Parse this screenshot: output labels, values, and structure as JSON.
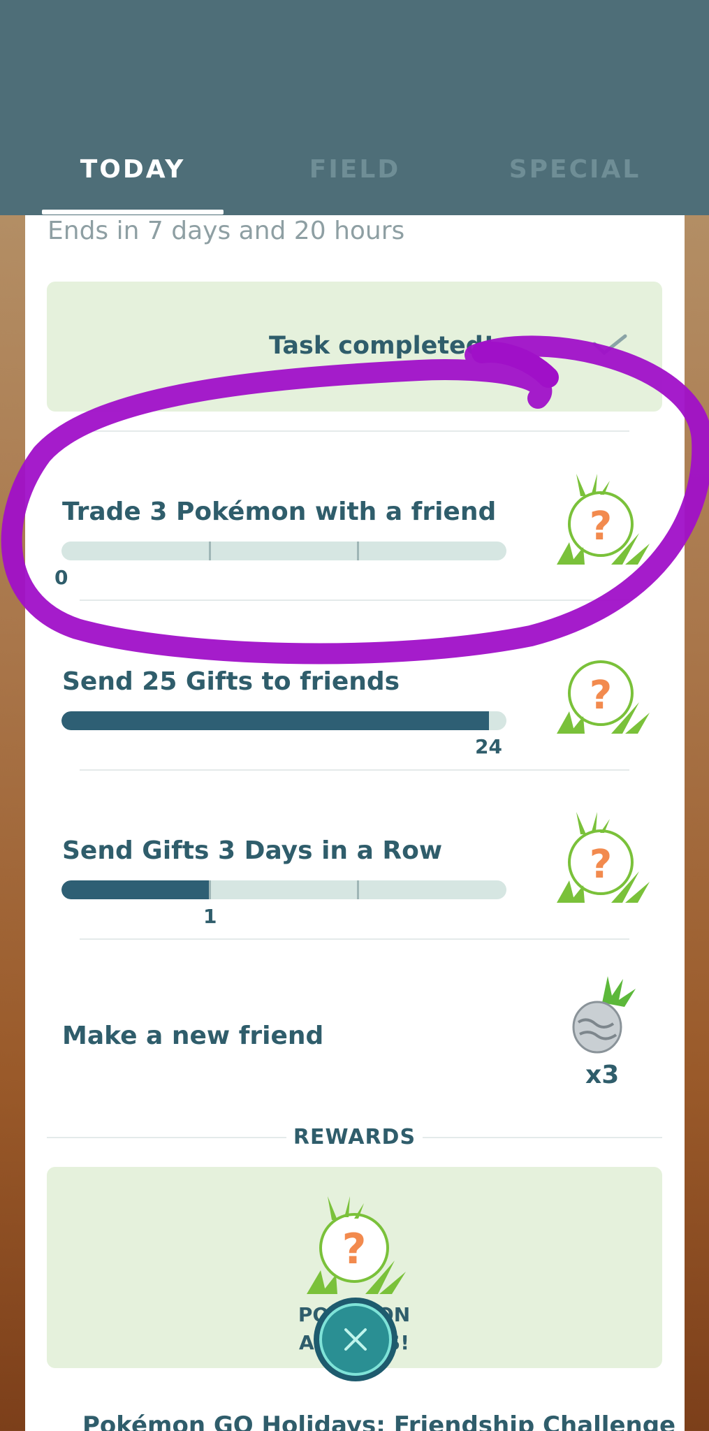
{
  "tabs": [
    {
      "label": "TODAY",
      "active": true
    },
    {
      "label": "FIELD",
      "active": false
    },
    {
      "label": "SPECIAL",
      "active": false
    }
  ],
  "ends_text": "Ends in 7 days and 20 hours",
  "completed": {
    "label": "Task completed!",
    "icon": "checkmark-icon"
  },
  "tasks": [
    {
      "title": "Trade 3 Pokémon with a friend",
      "progress_label": "0",
      "progress": 0.0,
      "segments": 3,
      "reward_icon": "mystery-pokemon-encounter-icon"
    },
    {
      "title": "Send 25 Gifts to friends",
      "progress_label": "24",
      "progress": 0.96,
      "segments": 1,
      "reward_icon": "mystery-pokemon-encounter-icon"
    },
    {
      "title": "Send Gifts 3 Days in a Row",
      "progress_label": "1",
      "progress": 0.3333,
      "segments": 3,
      "reward_icon": "mystery-pokemon-encounter-icon"
    },
    {
      "title": "Make a new friend",
      "reward_icon": "silver-pinap-berry-icon",
      "reward_count": "x3"
    }
  ],
  "rewards": {
    "label": "REWARDS",
    "text_line1": "POKÉMON",
    "text_line2": "APPEARS!",
    "icon": "mystery-pokemon-encounter-icon"
  },
  "footer_title": "Pokémon GO Holidays: Friendship Challenge",
  "close_icon": "close-icon",
  "colors": {
    "header": "#4e6e78",
    "accent": "#2e5f74",
    "track": "#d6e6e2",
    "box": "#e5f1dc",
    "scribble": "#a010c8",
    "question": "#f28a4e",
    "grass": "#7ac13a"
  }
}
